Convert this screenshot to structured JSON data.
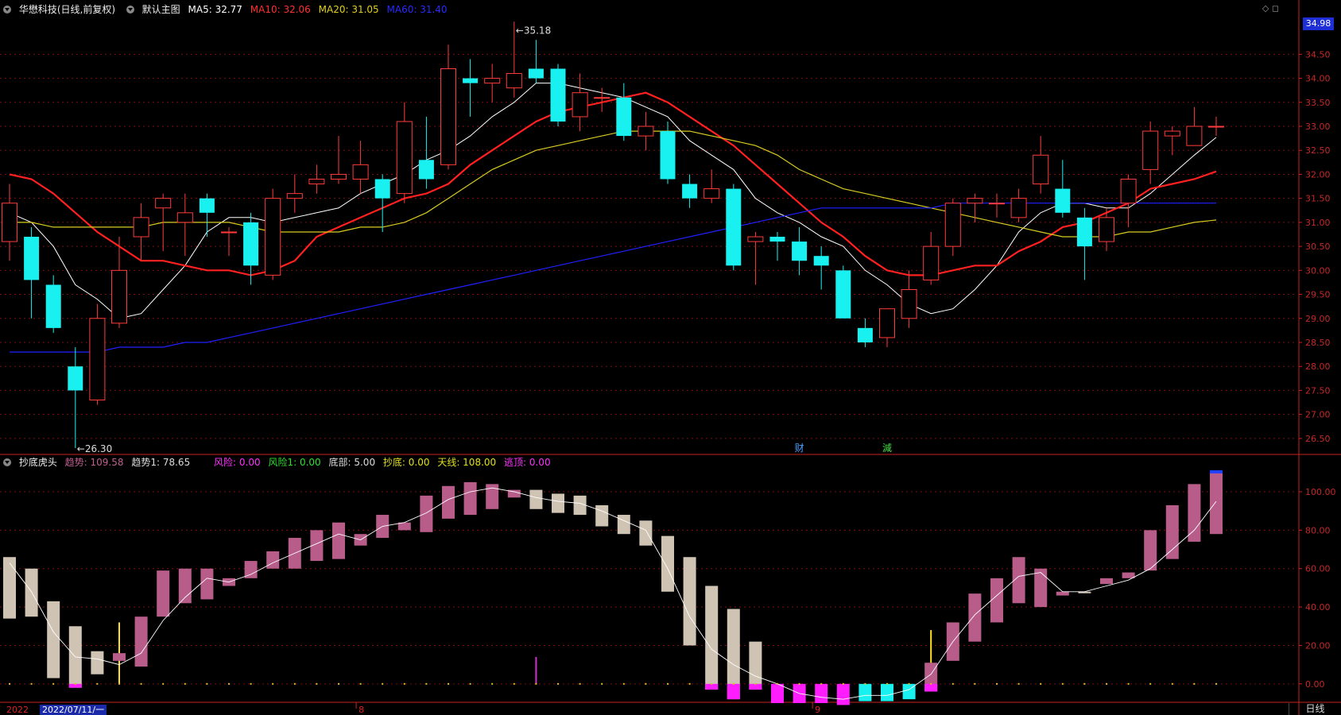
{
  "header_main": {
    "title": "华懋科技(日线,前复权)",
    "template": "默认主图",
    "ma5": "MA5: 32.77",
    "ma10": "MA10: 32.06",
    "ma20": "MA20: 31.05",
    "ma60": "MA60: 31.40"
  },
  "header_ind": {
    "name": "抄底虎头",
    "trend": "趋势: 109.58",
    "trend1": "趋势1: 78.65",
    "risk": "风险: 0.00",
    "risk1": "风险1: 0.00",
    "bottom": "底部: 5.00",
    "buy": "抄底: 0.00",
    "sky": "天线: 108.00",
    "escape": "逃顶: 0.00"
  },
  "price_tag": "34.98",
  "period_button": "日线",
  "date_label": "2022/07/11/一",
  "year_label": "2022",
  "corner_icons": "◇ ◻",
  "colors": {
    "up": "#ff3b3b",
    "down": "#19f0f0",
    "ma5": "#ffffff",
    "ma10": "#ff2020",
    "ma20": "#d8cc20",
    "ma60": "#2020ff",
    "ind_up": "#b85c8a",
    "ind_down": "#cfc4b3",
    "ind_neg": "#ff1cff",
    "ind_neg2": "#19f0f0",
    "grid": "#7a1010",
    "axis": "#cc2222"
  },
  "chart_data": [
    {
      "type": "candlestick",
      "title": "华懋科技(日线,前复权)",
      "y_ticks": [
        "34.50",
        "34.00",
        "33.50",
        "33.00",
        "32.50",
        "32.00",
        "31.50",
        "31.00",
        "30.50",
        "30.00",
        "29.50",
        "29.00",
        "28.50",
        "28.00",
        "27.50",
        "27.00",
        "26.50"
      ],
      "ylim": [
        26.2,
        35.3
      ],
      "max_label": "35.18",
      "min_label": "26.30",
      "markers": [
        "财",
        "減"
      ],
      "month_labels": [
        "8",
        "9"
      ],
      "candles": [
        {
          "o": 30.6,
          "c": 31.4,
          "h": 31.8,
          "l": 30.2
        },
        {
          "o": 30.7,
          "c": 29.8,
          "h": 30.9,
          "l": 29.0
        },
        {
          "o": 29.7,
          "c": 28.8,
          "h": 29.9,
          "l": 28.7
        },
        {
          "o": 28.0,
          "c": 27.5,
          "h": 28.4,
          "l": 26.3
        },
        {
          "o": 27.3,
          "c": 29.0,
          "h": 29.3,
          "l": 27.2
        },
        {
          "o": 28.9,
          "c": 30.0,
          "h": 30.7,
          "l": 28.8
        },
        {
          "o": 30.7,
          "c": 31.1,
          "h": 31.4,
          "l": 30.2
        },
        {
          "o": 31.3,
          "c": 31.5,
          "h": 31.6,
          "l": 30.4
        },
        {
          "o": 31.0,
          "c": 31.2,
          "h": 31.6,
          "l": 30.3
        },
        {
          "o": 31.5,
          "c": 31.2,
          "h": 31.6,
          "l": 30.7
        },
        {
          "o": 30.8,
          "c": 30.8,
          "h": 30.9,
          "l": 30.3
        },
        {
          "o": 31.0,
          "c": 30.1,
          "h": 31.2,
          "l": 29.7
        },
        {
          "o": 29.9,
          "c": 31.5,
          "h": 31.7,
          "l": 29.8
        },
        {
          "o": 31.5,
          "c": 31.6,
          "h": 32.0,
          "l": 31.2
        },
        {
          "o": 31.8,
          "c": 31.9,
          "h": 32.2,
          "l": 31.6
        },
        {
          "o": 31.9,
          "c": 32.0,
          "h": 32.8,
          "l": 31.8
        },
        {
          "o": 31.9,
          "c": 32.2,
          "h": 32.7,
          "l": 31.6
        },
        {
          "o": 31.9,
          "c": 31.5,
          "h": 32.0,
          "l": 30.8
        },
        {
          "o": 31.6,
          "c": 33.1,
          "h": 33.5,
          "l": 31.4
        },
        {
          "o": 32.3,
          "c": 31.9,
          "h": 33.2,
          "l": 31.7
        },
        {
          "o": 32.2,
          "c": 34.2,
          "h": 34.7,
          "l": 32.1
        },
        {
          "o": 34.0,
          "c": 33.9,
          "h": 34.4,
          "l": 33.2
        },
        {
          "o": 33.9,
          "c": 34.0,
          "h": 34.3,
          "l": 33.5
        },
        {
          "o": 33.8,
          "c": 34.1,
          "h": 35.18,
          "l": 33.6
        },
        {
          "o": 34.2,
          "c": 34.0,
          "h": 34.8,
          "l": 33.9
        },
        {
          "o": 34.2,
          "c": 33.1,
          "h": 34.3,
          "l": 33.0
        },
        {
          "o": 33.2,
          "c": 33.7,
          "h": 34.1,
          "l": 32.9
        },
        {
          "o": 33.6,
          "c": 33.6,
          "h": 33.8,
          "l": 33.3
        },
        {
          "o": 33.6,
          "c": 32.8,
          "h": 33.9,
          "l": 32.7
        },
        {
          "o": 32.8,
          "c": 33.0,
          "h": 33.3,
          "l": 32.5
        },
        {
          "o": 32.9,
          "c": 31.9,
          "h": 33.1,
          "l": 31.8
        },
        {
          "o": 31.8,
          "c": 31.5,
          "h": 32.0,
          "l": 31.3
        },
        {
          "o": 31.5,
          "c": 31.7,
          "h": 32.1,
          "l": 31.4
        },
        {
          "o": 31.7,
          "c": 30.1,
          "h": 31.8,
          "l": 30.0
        },
        {
          "o": 30.6,
          "c": 30.7,
          "h": 30.8,
          "l": 29.7
        },
        {
          "o": 30.7,
          "c": 30.6,
          "h": 30.8,
          "l": 30.2
        },
        {
          "o": 30.6,
          "c": 30.2,
          "h": 30.9,
          "l": 29.9
        },
        {
          "o": 30.3,
          "c": 30.1,
          "h": 30.5,
          "l": 29.6
        },
        {
          "o": 30.0,
          "c": 29.0,
          "h": 30.1,
          "l": 29.0
        },
        {
          "o": 28.8,
          "c": 28.5,
          "h": 29.0,
          "l": 28.4
        },
        {
          "o": 28.6,
          "c": 29.2,
          "h": 29.2,
          "l": 28.4
        },
        {
          "o": 29.0,
          "c": 29.6,
          "h": 30.0,
          "l": 28.8
        },
        {
          "o": 29.8,
          "c": 30.5,
          "h": 30.8,
          "l": 29.7
        },
        {
          "o": 30.5,
          "c": 31.4,
          "h": 31.5,
          "l": 30.3
        },
        {
          "o": 31.4,
          "c": 31.5,
          "h": 31.6,
          "l": 31.0
        },
        {
          "o": 31.4,
          "c": 31.4,
          "h": 31.6,
          "l": 31.1
        },
        {
          "o": 31.1,
          "c": 31.5,
          "h": 31.7,
          "l": 31.0
        },
        {
          "o": 31.8,
          "c": 32.4,
          "h": 32.8,
          "l": 31.6
        },
        {
          "o": 31.7,
          "c": 31.2,
          "h": 32.3,
          "l": 31.1
        },
        {
          "o": 31.1,
          "c": 30.5,
          "h": 31.3,
          "l": 29.8
        },
        {
          "o": 30.6,
          "c": 31.1,
          "h": 31.3,
          "l": 30.4
        },
        {
          "o": 31.4,
          "c": 31.9,
          "h": 32.0,
          "l": 30.9
        },
        {
          "o": 32.1,
          "c": 32.9,
          "h": 33.1,
          "l": 31.8
        },
        {
          "o": 32.8,
          "c": 32.9,
          "h": 33.0,
          "l": 32.4
        },
        {
          "o": 32.6,
          "c": 33.0,
          "h": 33.4,
          "l": 32.6
        },
        {
          "o": 33.0,
          "c": 33.0,
          "h": 33.2,
          "l": 32.8
        }
      ],
      "series": [
        {
          "name": "MA5",
          "values": [
            31.2,
            31.0,
            30.5,
            29.7,
            29.4,
            29.0,
            29.1,
            29.6,
            30.1,
            30.8,
            31.1,
            31.1,
            31.0,
            31.1,
            31.2,
            31.3,
            31.6,
            31.8,
            32.0,
            32.3,
            32.5,
            32.8,
            33.2,
            33.5,
            33.9,
            33.9,
            33.8,
            33.7,
            33.6,
            33.4,
            33.2,
            32.7,
            32.4,
            32.1,
            31.5,
            31.2,
            31.0,
            30.7,
            30.5,
            30.0,
            29.7,
            29.3,
            29.1,
            29.2,
            29.6,
            30.1,
            30.8,
            31.2,
            31.4,
            31.4,
            31.3,
            31.3,
            31.6,
            32.0,
            32.4,
            32.77
          ]
        },
        {
          "name": "MA10",
          "values": [
            32.0,
            31.9,
            31.6,
            31.2,
            30.8,
            30.5,
            30.2,
            30.2,
            30.1,
            30.0,
            30.0,
            29.9,
            30.0,
            30.2,
            30.7,
            30.9,
            31.1,
            31.3,
            31.5,
            31.6,
            31.8,
            32.2,
            32.5,
            32.8,
            33.1,
            33.3,
            33.4,
            33.5,
            33.6,
            33.7,
            33.5,
            33.2,
            32.9,
            32.6,
            32.2,
            31.8,
            31.4,
            31.0,
            30.7,
            30.3,
            30.0,
            29.9,
            29.9,
            30.0,
            30.1,
            30.1,
            30.4,
            30.6,
            30.9,
            31.0,
            31.2,
            31.4,
            31.7,
            31.8,
            31.9,
            32.06
          ]
        },
        {
          "name": "MA20",
          "values": [
            31.0,
            31.0,
            30.9,
            30.9,
            30.9,
            30.9,
            30.9,
            31.0,
            31.0,
            31.0,
            31.0,
            30.9,
            30.8,
            30.8,
            30.8,
            30.8,
            30.9,
            30.9,
            31.0,
            31.2,
            31.5,
            31.8,
            32.1,
            32.3,
            32.5,
            32.6,
            32.7,
            32.8,
            32.9,
            32.9,
            32.9,
            32.9,
            32.8,
            32.7,
            32.6,
            32.4,
            32.1,
            31.9,
            31.7,
            31.6,
            31.5,
            31.4,
            31.3,
            31.2,
            31.1,
            31.0,
            30.9,
            30.8,
            30.7,
            30.7,
            30.7,
            30.8,
            30.8,
            30.9,
            31.0,
            31.05
          ]
        },
        {
          "name": "MA60",
          "values": [
            28.3,
            28.3,
            28.3,
            28.3,
            28.3,
            28.4,
            28.4,
            28.4,
            28.5,
            28.5,
            28.6,
            28.7,
            28.8,
            28.9,
            29.0,
            29.1,
            29.2,
            29.3,
            29.4,
            29.5,
            29.6,
            29.7,
            29.8,
            29.9,
            30.0,
            30.1,
            30.2,
            30.3,
            30.4,
            30.5,
            30.6,
            30.7,
            30.8,
            30.9,
            31.0,
            31.1,
            31.2,
            31.3,
            31.3,
            31.3,
            31.3,
            31.3,
            31.3,
            31.4,
            31.4,
            31.4,
            31.4,
            31.4,
            31.4,
            31.4,
            31.4,
            31.4,
            31.4,
            31.4,
            31.4,
            31.4
          ]
        }
      ]
    },
    {
      "type": "bar",
      "title": "抄底虎头",
      "y_ticks": [
        "100.00",
        "80.00",
        "60.00",
        "40.00",
        "20.00",
        "0.00"
      ],
      "ylim": [
        -10,
        112
      ],
      "bars": [
        {
          "a": 66,
          "b": 34,
          "c": "down"
        },
        {
          "a": 60,
          "b": 35,
          "c": "down"
        },
        {
          "a": 43,
          "b": 3,
          "c": "down"
        },
        {
          "a": 30,
          "b": -2,
          "c": "down"
        },
        {
          "a": 17,
          "b": 5,
          "c": "down"
        },
        {
          "a": 12,
          "b": 16,
          "c": "up"
        },
        {
          "a": 9,
          "b": 35,
          "c": "up"
        },
        {
          "a": 35,
          "b": 59,
          "c": "up"
        },
        {
          "a": 42,
          "b": 60,
          "c": "up"
        },
        {
          "a": 44,
          "b": 60,
          "c": "up"
        },
        {
          "a": 51,
          "b": 55,
          "c": "up"
        },
        {
          "a": 55,
          "b": 64,
          "c": "up"
        },
        {
          "a": 60,
          "b": 69,
          "c": "up"
        },
        {
          "a": 60,
          "b": 76,
          "c": "up"
        },
        {
          "a": 64,
          "b": 80,
          "c": "up"
        },
        {
          "a": 65,
          "b": 84,
          "c": "up"
        },
        {
          "a": 72,
          "b": 78,
          "c": "up"
        },
        {
          "a": 76,
          "b": 88,
          "c": "up"
        },
        {
          "a": 80,
          "b": 84,
          "c": "up"
        },
        {
          "a": 79,
          "b": 98,
          "c": "up"
        },
        {
          "a": 86,
          "b": 103,
          "c": "up"
        },
        {
          "a": 88,
          "b": 105,
          "c": "up"
        },
        {
          "a": 91,
          "b": 104,
          "c": "up"
        },
        {
          "a": 97,
          "b": 101,
          "c": "up"
        },
        {
          "a": 101,
          "b": 91,
          "c": "down"
        },
        {
          "a": 99,
          "b": 89,
          "c": "down"
        },
        {
          "a": 98,
          "b": 88,
          "c": "down"
        },
        {
          "a": 93,
          "b": 82,
          "c": "down"
        },
        {
          "a": 88,
          "b": 78,
          "c": "down"
        },
        {
          "a": 85,
          "b": 72,
          "c": "down"
        },
        {
          "a": 77,
          "b": 48,
          "c": "down"
        },
        {
          "a": 66,
          "b": 20,
          "c": "down"
        },
        {
          "a": 51,
          "b": -3,
          "c": "down"
        },
        {
          "a": 39,
          "b": -8,
          "c": "down"
        },
        {
          "a": 22,
          "b": -3,
          "c": "down"
        },
        {
          "a": 0,
          "b": -10,
          "c": "neg"
        },
        {
          "a": 0,
          "b": -10,
          "c": "neg"
        },
        {
          "a": 0,
          "b": -10,
          "c": "neg"
        },
        {
          "a": 0,
          "b": -11,
          "c": "neg"
        },
        {
          "a": 0,
          "b": -9,
          "c": "cyan"
        },
        {
          "a": 0,
          "b": -9,
          "c": "cyan"
        },
        {
          "a": 0,
          "b": -8,
          "c": "cyan"
        },
        {
          "a": -4,
          "b": 11,
          "c": "up"
        },
        {
          "a": 12,
          "b": 32,
          "c": "up"
        },
        {
          "a": 22,
          "b": 47,
          "c": "up"
        },
        {
          "a": 32,
          "b": 55,
          "c": "up"
        },
        {
          "a": 42,
          "b": 66,
          "c": "up"
        },
        {
          "a": 40,
          "b": 60,
          "c": "up"
        },
        {
          "a": 48,
          "b": 46,
          "c": "up"
        },
        {
          "a": 48,
          "b": 48,
          "c": "down"
        },
        {
          "a": 52,
          "b": 55,
          "c": "up"
        },
        {
          "a": 55,
          "b": 58,
          "c": "up"
        },
        {
          "a": 59,
          "b": 80,
          "c": "up"
        },
        {
          "a": 65,
          "b": 93,
          "c": "up"
        },
        {
          "a": 74,
          "b": 104,
          "c": "up"
        },
        {
          "a": 78,
          "b": 110,
          "c": "up"
        }
      ],
      "trend_line": [
        63,
        48,
        27,
        14,
        13,
        10,
        16,
        33,
        45,
        55,
        53,
        57,
        63,
        68,
        73,
        78,
        75,
        82,
        84,
        89,
        96,
        100,
        102,
        100,
        97,
        95,
        94,
        90,
        85,
        80,
        60,
        35,
        18,
        10,
        4,
        0,
        -5,
        -7,
        -8,
        -6,
        -6,
        -3,
        5,
        22,
        36,
        46,
        56,
        58,
        48,
        48,
        51,
        54,
        60,
        70,
        80,
        95
      ],
      "spikes": [
        {
          "i": 5,
          "v": 32,
          "color": "yellow"
        },
        {
          "i": 24,
          "v": 14,
          "color": "magenta"
        },
        {
          "i": 42,
          "v": 28,
          "color": "yellow"
        }
      ]
    }
  ]
}
